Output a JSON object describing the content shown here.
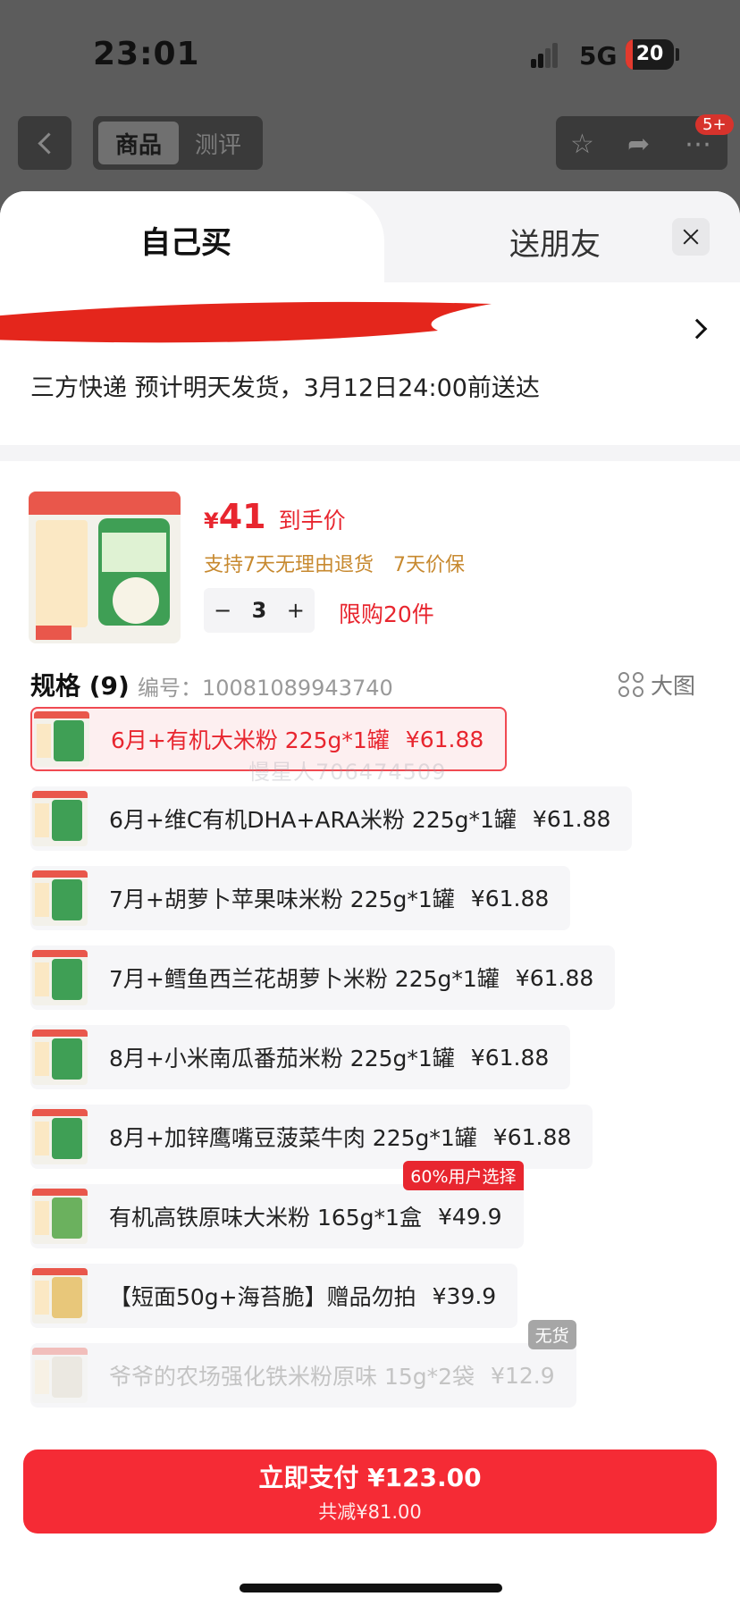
{
  "status": {
    "time": "23:01",
    "network": "5G",
    "battery": "20"
  },
  "topnav": {
    "tab_product": "商品",
    "tab_review": "测评",
    "msg_badge": "5+"
  },
  "sheet": {
    "tab_self": "自己买",
    "tab_gift": "送朋友",
    "shipping": "三方快递 预计明天发货，3月12日24:00前送达",
    "product": {
      "price_symbol": "¥",
      "price_value": "41",
      "price_label": "到手价",
      "guarantee_1": "支持7天无理由退货",
      "guarantee_2": "7天价保",
      "quantity": "3",
      "minus": "−",
      "plus": "+",
      "limit": "限购20件"
    },
    "spec": {
      "title": "规格 (9)",
      "code": "编号：10081089943740",
      "big_image": "大图"
    },
    "options": [
      {
        "name": "6月+有机大米粉 225g*1罐",
        "price": "¥61.88",
        "state": "selected"
      },
      {
        "name": "6月+维C有机DHA+ARA米粉 225g*1罐",
        "price": "¥61.88",
        "state": "normal"
      },
      {
        "name": "7月+胡萝卜苹果味米粉 225g*1罐",
        "price": "¥61.88",
        "state": "normal"
      },
      {
        "name": "7月+鳕鱼西兰花胡萝卜米粉 225g*1罐",
        "price": "¥61.88",
        "state": "normal"
      },
      {
        "name": "8月+小米南瓜番茄米粉 225g*1罐",
        "price": "¥61.88",
        "state": "normal"
      },
      {
        "name": "8月+加锌鹰嘴豆菠菜牛肉 225g*1罐",
        "price": "¥61.88",
        "state": "normal"
      },
      {
        "name": "有机高铁原味大米粉 165g*1盒",
        "price": "¥49.9",
        "state": "normal",
        "tag": "60%用户选择"
      },
      {
        "name": "【短面50g+海苔脆】赠品勿拍",
        "price": "¥39.9",
        "state": "normal"
      },
      {
        "name": "爷爷的农场强化铁米粉原味 15g*2袋",
        "price": "¥12.9",
        "state": "disabled",
        "tag": "无货"
      }
    ],
    "watermark": "慢星人706474509",
    "pay": {
      "label": "立即支付 ¥123.00",
      "discount": "共减¥81.00"
    }
  },
  "colors": {
    "accent": "#e8262f",
    "guarantee": "#c7892f",
    "pay_button": "#f52b35"
  }
}
